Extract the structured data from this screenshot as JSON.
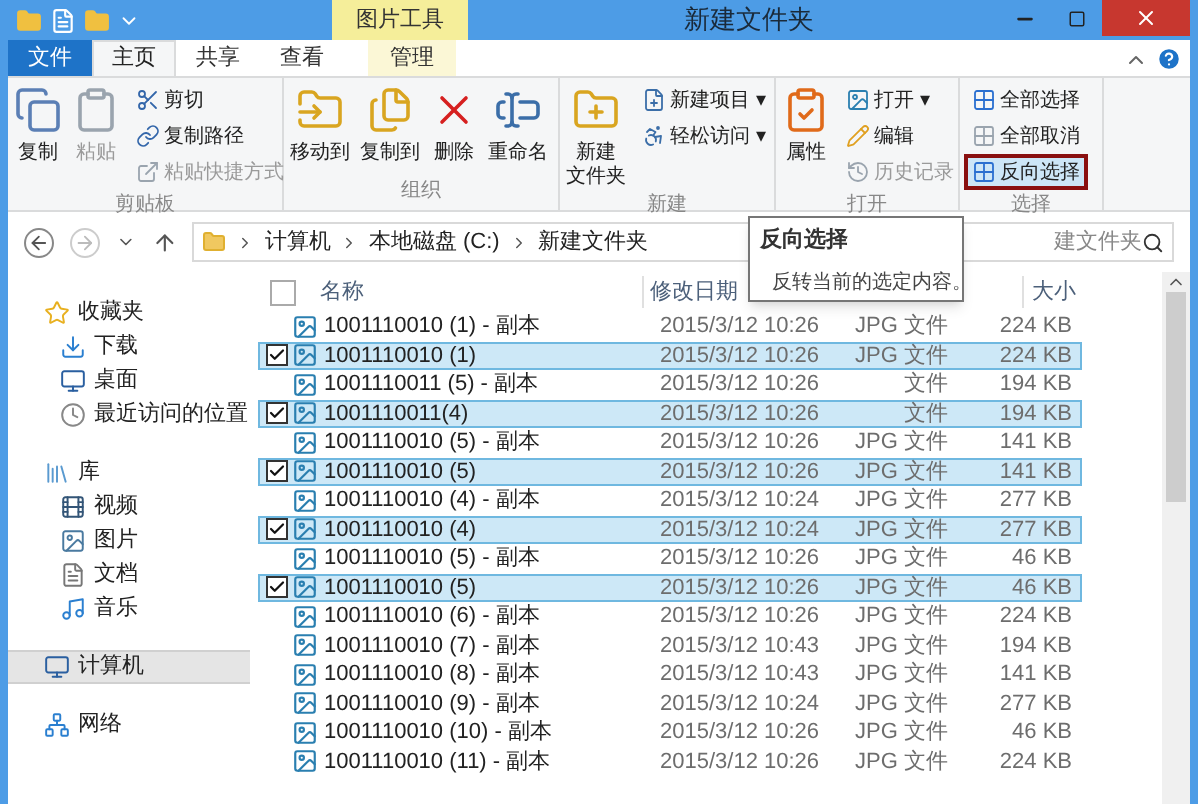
{
  "window": {
    "title": "新建文件夹",
    "context_tab": "图片工具"
  },
  "tabs": [
    {
      "label": "文件",
      "kind": "file",
      "selected": false
    },
    {
      "label": "主页",
      "kind": "tab",
      "selected": true
    },
    {
      "label": "共享",
      "kind": "tab",
      "selected": false
    },
    {
      "label": "查看",
      "kind": "tab",
      "selected": false
    },
    {
      "label": "管理",
      "kind": "context",
      "selected": false
    }
  ],
  "ribbon": [
    {
      "name": "剪贴板",
      "items": [
        {
          "label": "复制",
          "kind": "big",
          "disabled": false
        },
        {
          "label": "粘贴",
          "kind": "big",
          "disabled": true
        },
        {
          "label": "剪切",
          "kind": "small",
          "disabled": false
        },
        {
          "label": "复制路径",
          "kind": "small",
          "disabled": false
        },
        {
          "label": "粘贴快捷方式",
          "kind": "small",
          "disabled": true
        }
      ]
    },
    {
      "name": "组织",
      "items": [
        {
          "label": "移动到",
          "kind": "big",
          "disabled": false
        },
        {
          "label": "复制到",
          "kind": "big",
          "disabled": false
        },
        {
          "label": "删除",
          "kind": "big",
          "disabled": false
        },
        {
          "label": "重命名",
          "kind": "big",
          "disabled": false
        }
      ]
    },
    {
      "name": "新建",
      "items": [
        {
          "label": [
            "新建",
            "文件夹"
          ],
          "kind": "big",
          "disabled": false
        },
        {
          "label": "新建项目 ▾",
          "kind": "small",
          "disabled": false
        },
        {
          "label": "轻松访问 ▾",
          "kind": "small",
          "disabled": false
        }
      ]
    },
    {
      "name": "打开",
      "items": [
        {
          "label": "属性",
          "kind": "big",
          "disabled": false
        },
        {
          "label": "打开 ▾",
          "kind": "small",
          "disabled": false
        },
        {
          "label": "编辑",
          "kind": "small",
          "disabled": false
        },
        {
          "label": "历史记录",
          "kind": "small",
          "disabled": true
        }
      ]
    },
    {
      "name": "选择",
      "items": [
        {
          "label": "全部选择",
          "kind": "small",
          "disabled": false,
          "highlighted": false
        },
        {
          "label": "全部取消",
          "kind": "small",
          "disabled": false,
          "highlighted": false
        },
        {
          "label": "反向选择",
          "kind": "small",
          "disabled": false,
          "highlighted": true
        }
      ]
    }
  ],
  "address": {
    "path": [
      "计算机",
      "本地磁盘 (C:)",
      "新建文件夹"
    ],
    "search_placeholder": "建文件夹"
  },
  "tooltip": {
    "title": "反向选择",
    "text": "反转当前的选定内容。"
  },
  "sidebar": [
    {
      "label": "收藏夹",
      "selected": false,
      "children": [
        {
          "label": "下载",
          "selected": false
        },
        {
          "label": "桌面",
          "selected": false
        },
        {
          "label": "最近访问的位置",
          "selected": false
        }
      ]
    },
    {
      "label": "库",
      "selected": false,
      "children": [
        {
          "label": "视频",
          "selected": false
        },
        {
          "label": "图片",
          "selected": false
        },
        {
          "label": "文档",
          "selected": false
        },
        {
          "label": "音乐",
          "selected": false
        }
      ]
    },
    {
      "label": "计算机",
      "selected": true
    },
    {
      "label": "网络",
      "selected": false
    }
  ],
  "table": {
    "select_all": {
      "checked": false
    },
    "columns": [
      "名称",
      "修改日期",
      "大小"
    ],
    "rows": [
      {
        "name": "1001110010 (1) - 副本",
        "date": "2015/3/12 10:26",
        "type": "JPG 文件",
        "size": "224 KB",
        "selected": false
      },
      {
        "name": "1001110010 (1)",
        "date": "2015/3/12 10:26",
        "type": "JPG 文件",
        "size": "224 KB",
        "selected": true
      },
      {
        "name": "1001110011 (5) - 副本",
        "date": "2015/3/12 10:26",
        "type": "文件",
        "size": "194 KB",
        "selected": false
      },
      {
        "name": "1001110011(4)",
        "date": "2015/3/12 10:26",
        "type": "文件",
        "size": "194 KB",
        "selected": true
      },
      {
        "name": "1001110010 (5) - 副本",
        "date": "2015/3/12 10:26",
        "type": "JPG 文件",
        "size": "141 KB",
        "selected": false
      },
      {
        "name": "1001110010 (5)",
        "date": "2015/3/12 10:26",
        "type": "JPG 文件",
        "size": "141 KB",
        "selected": true
      },
      {
        "name": "1001110010 (4) - 副本",
        "date": "2015/3/12 10:24",
        "type": "JPG 文件",
        "size": "277 KB",
        "selected": false
      },
      {
        "name": "1001110010 (4)",
        "date": "2015/3/12 10:24",
        "type": "JPG 文件",
        "size": "277 KB",
        "selected": true
      },
      {
        "name": "1001110010 (5) - 副本",
        "date": "2015/3/12 10:26",
        "type": "JPG 文件",
        "size": "46 KB",
        "selected": false
      },
      {
        "name": "1001110010 (5)",
        "date": "2015/3/12 10:26",
        "type": "JPG 文件",
        "size": "46 KB",
        "selected": true
      },
      {
        "name": "1001110010 (6) - 副本",
        "date": "2015/3/12 10:26",
        "type": "JPG 文件",
        "size": "224 KB",
        "selected": false
      },
      {
        "name": "1001110010 (7) - 副本",
        "date": "2015/3/12 10:43",
        "type": "JPG 文件",
        "size": "194 KB",
        "selected": false
      },
      {
        "name": "1001110010 (8) - 副本",
        "date": "2015/3/12 10:43",
        "type": "JPG 文件",
        "size": "141 KB",
        "selected": false
      },
      {
        "name": "1001110010 (9) - 副本",
        "date": "2015/3/12 10:24",
        "type": "JPG 文件",
        "size": "277 KB",
        "selected": false
      },
      {
        "name": "1001110010 (10) - 副本",
        "date": "2015/3/12 10:26",
        "type": "JPG 文件",
        "size": "46 KB",
        "selected": false
      },
      {
        "name": "1001110010 (11) - 副本",
        "date": "2015/3/12 10:26",
        "type": "JPG 文件",
        "size": "224 KB",
        "selected": false
      }
    ]
  }
}
